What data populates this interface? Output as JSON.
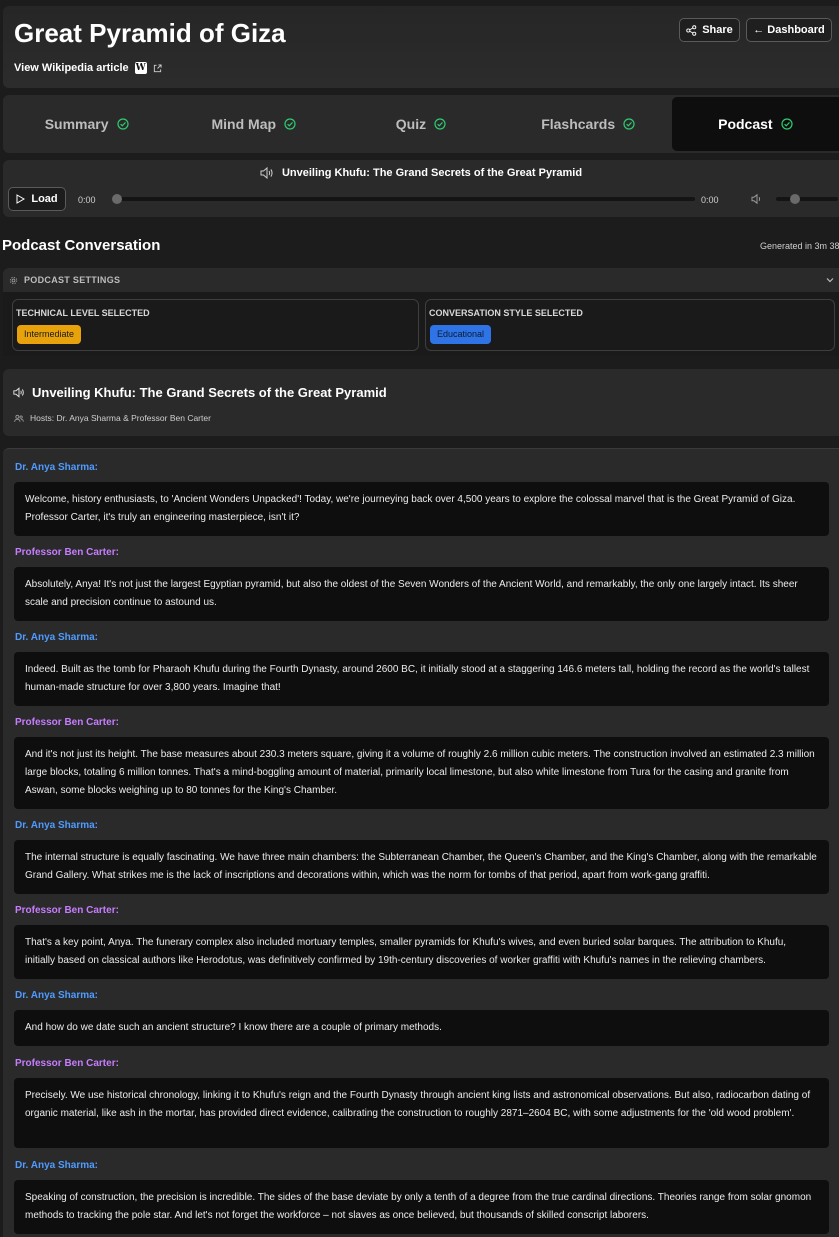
{
  "header": {
    "title": "Great Pyramid of Giza",
    "wiki_link": "View Wikipedia article",
    "wiki_badge": "W",
    "share_label": "Share",
    "dashboard_label": "← Dashboard"
  },
  "tabs": [
    {
      "label": "Summary",
      "done": true,
      "active": false
    },
    {
      "label": "Mind Map",
      "done": true,
      "active": false
    },
    {
      "label": "Quiz",
      "done": true,
      "active": false
    },
    {
      "label": "Flashcards",
      "done": true,
      "active": false
    },
    {
      "label": "Podcast",
      "done": true,
      "active": true
    }
  ],
  "player": {
    "title": "Unveiling Khufu: The Grand Secrets of the Great Pyramid",
    "load_label": "Load",
    "current_time": "0:00",
    "duration": "0:00",
    "progress": 0,
    "volume": 0.3
  },
  "podcast": {
    "heading": "Podcast Conversation",
    "generated": "Generated in 3m 38"
  },
  "settings": {
    "header": "PODCAST SETTINGS",
    "technical_label": "TECHNICAL LEVEL SELECTED",
    "technical_value": "Intermediate",
    "style_label": "CONVERSATION STYLE SELECTED",
    "style_value": "Educational"
  },
  "episode": {
    "title": "Unveiling Khufu: The Grand Secrets of the Great Pyramid",
    "hosts": "Hosts: Dr. Anya Sharma & Professor Ben Carter"
  },
  "colors": {
    "anya": "#4f9bff",
    "ben": "#c77dff",
    "check": "#2ecc71"
  },
  "messages": [
    {
      "speaker": "Dr. Anya Sharma:",
      "host": "anya",
      "text": "Welcome, history enthusiasts, to 'Ancient Wonders Unpacked'! Today, we're journeying back over 4,500 years to explore the colossal marvel that is the Great Pyramid of Giza. Professor Carter, it's truly an engineering masterpiece, isn't it?"
    },
    {
      "speaker": "Professor Ben Carter:",
      "host": "ben",
      "text": "Absolutely, Anya! It's not just the largest Egyptian pyramid, but also the oldest of the Seven Wonders of the Ancient World, and remarkably, the only one largely intact. Its sheer scale and precision continue to astound us."
    },
    {
      "speaker": "Dr. Anya Sharma:",
      "host": "anya",
      "text": "Indeed. Built as the tomb for Pharaoh Khufu during the Fourth Dynasty, around 2600 BC, it initially stood at a staggering 146.6 meters tall, holding the record as the world's tallest human-made structure for over 3,800 years. Imagine that!"
    },
    {
      "speaker": "Professor Ben Carter:",
      "host": "ben",
      "text": "And it's not just its height. The base measures about 230.3 meters square, giving it a volume of roughly 2.6 million cubic meters. The construction involved an estimated 2.3 million large blocks, totaling 6 million tonnes. That's a mind-boggling amount of material, primarily local limestone, but also white limestone from Tura for the casing and granite from Aswan, some blocks weighing up to 80 tonnes for the King's Chamber."
    },
    {
      "speaker": "Dr. Anya Sharma:",
      "host": "anya",
      "text": "The internal structure is equally fascinating. We have three main chambers: the Subterranean Chamber, the Queen's Chamber, and the King's Chamber, along with the remarkable Grand Gallery. What strikes me is the lack of inscriptions and decorations within, which was the norm for tombs of that period, apart from work-gang graffiti."
    },
    {
      "speaker": "Professor Ben Carter:",
      "host": "ben",
      "text": "That's a key point, Anya. The funerary complex also included mortuary temples, smaller pyramids for Khufu's wives, and even buried solar barques. The attribution to Khufu, initially based on classical authors like Herodotus, was definitively confirmed by 19th-century discoveries of worker graffiti with Khufu's names in the relieving chambers."
    },
    {
      "speaker": "Dr. Anya Sharma:",
      "host": "anya",
      "text": "And how do we date such an ancient structure? I know there are a couple of primary methods."
    },
    {
      "speaker": "Professor Ben Carter:",
      "host": "ben",
      "text": "Precisely. We use historical chronology, linking it to Khufu's reign and the Fourth Dynasty through ancient king lists and astronomical observations. But also, radiocarbon dating of organic material, like ash in the mortar, has provided direct evidence, calibrating the construction to roughly 2871–2604 BC, with some adjustments for the 'old wood problem'."
    },
    {
      "speaker": "Dr. Anya Sharma:",
      "host": "anya",
      "text": "Speaking of construction, the precision is incredible. The sides of the base deviate by only a tenth of a degree from the true cardinal directions. Theories range from solar gnomon methods to tracking the pole star. And let's not forget the workforce – not slaves as once believed, but thousands of skilled conscript laborers."
    }
  ]
}
